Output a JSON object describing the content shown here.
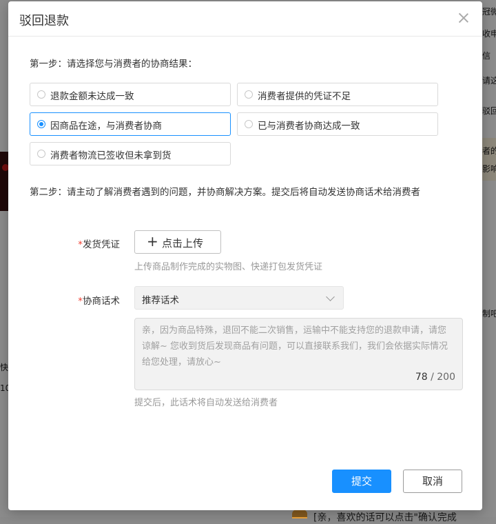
{
  "background": {
    "right_fragments": [
      "冠微",
      "收申",
      "信",
      "请这",
      "驳回",
      "者的",
      "影响",
      "制吧"
    ],
    "left_fragments": [
      "快",
      "10"
    ],
    "bottom_text": "[亲，喜欢的话可以点击\"确认完成"
  },
  "modal": {
    "title": "驳回退款",
    "step1_label": "第一步：请选择您与消费者的协商结果：",
    "options": [
      {
        "label": "退款金额未达成一致",
        "selected": false
      },
      {
        "label": "消费者提供的凭证不足",
        "selected": false
      },
      {
        "label": "因商品在途，与消费者协商",
        "selected": true
      },
      {
        "label": "已与消费者协商达成一致",
        "selected": false
      },
      {
        "label": "消费者物流已签收但未拿到货",
        "selected": false
      }
    ],
    "step2_label": "第二步：请主动了解消费者遇到的问题，并协商解决方案。提交后将自动发送协商话术给消费者",
    "proof": {
      "required_mark": "*",
      "label": "发货凭证",
      "upload_icon": "plus-icon",
      "upload_label": "点击上传",
      "hint": "上传商品制作完成的实物图、快递打包发货凭证"
    },
    "script": {
      "required_mark": "*",
      "label": "协商话术",
      "select_value": "推荐话术",
      "text": "亲，因为商品特殊，退回不能二次销售，运输中不能支持您的退款申请，请您谅解~ 您收到货后发现商品有问题，可以直接联系我们，我们会依据实际情况给您处理，请放心~",
      "count": "78",
      "separator": "/",
      "max": "200",
      "hint": "提交后，此话术将自动发送给消费者"
    },
    "submit_label": "提交",
    "cancel_label": "取消"
  },
  "colors": {
    "primary": "#1890ff",
    "required": "#f04134",
    "overlay": "rgba(0,0,0,0.45)"
  }
}
